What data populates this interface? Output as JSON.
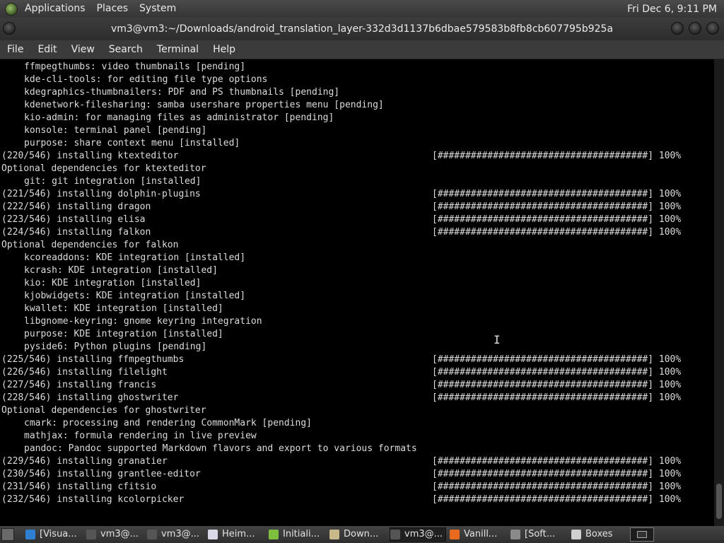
{
  "top_panel": {
    "menus": [
      "Applications",
      "Places",
      "System"
    ],
    "clock": "Fri Dec 6,  9:11 PM"
  },
  "window": {
    "title": "vm3@vm3:~/Downloads/android_translation_layer-332d3d1137b6dbae579583b8fb8cb607795b925a"
  },
  "menubar": [
    "File",
    "Edit",
    "View",
    "Search",
    "Terminal",
    "Help"
  ],
  "terminal": {
    "lines": [
      {
        "indent": true,
        "text": "ffmpegthumbs: video thumbnails [pending]",
        "bar": ""
      },
      {
        "indent": true,
        "text": "kde-cli-tools: for editing file type options",
        "bar": ""
      },
      {
        "indent": true,
        "text": "kdegraphics-thumbnailers: PDF and PS thumbnails [pending]",
        "bar": ""
      },
      {
        "indent": true,
        "text": "kdenetwork-filesharing: samba usershare properties menu [pending]",
        "bar": ""
      },
      {
        "indent": true,
        "text": "kio-admin: for managing files as administrator [pending]",
        "bar": ""
      },
      {
        "indent": true,
        "text": "konsole: terminal panel [pending]",
        "bar": ""
      },
      {
        "indent": true,
        "text": "purpose: share context menu [installed]",
        "bar": ""
      },
      {
        "indent": false,
        "text": "(220/546) installing ktexteditor",
        "bar": "[######################################] 100%"
      },
      {
        "indent": false,
        "text": "Optional dependencies for ktexteditor",
        "bar": ""
      },
      {
        "indent": true,
        "text": "git: git integration [installed]",
        "bar": ""
      },
      {
        "indent": false,
        "text": "(221/546) installing dolphin-plugins",
        "bar": "[######################################] 100%"
      },
      {
        "indent": false,
        "text": "(222/546) installing dragon",
        "bar": "[######################################] 100%"
      },
      {
        "indent": false,
        "text": "(223/546) installing elisa",
        "bar": "[######################################] 100%"
      },
      {
        "indent": false,
        "text": "(224/546) installing falkon",
        "bar": "[######################################] 100%"
      },
      {
        "indent": false,
        "text": "Optional dependencies for falkon",
        "bar": ""
      },
      {
        "indent": true,
        "text": "kcoreaddons: KDE integration [installed]",
        "bar": ""
      },
      {
        "indent": true,
        "text": "kcrash: KDE integration [installed]",
        "bar": ""
      },
      {
        "indent": true,
        "text": "kio: KDE integration [installed]",
        "bar": ""
      },
      {
        "indent": true,
        "text": "kjobwidgets: KDE integration [installed]",
        "bar": ""
      },
      {
        "indent": true,
        "text": "kwallet: KDE integration [installed]",
        "bar": ""
      },
      {
        "indent": true,
        "text": "libgnome-keyring: gnome keyring integration",
        "bar": ""
      },
      {
        "indent": true,
        "text": "purpose: KDE integration [installed]",
        "bar": ""
      },
      {
        "indent": true,
        "text": "pyside6: Python plugins [pending]",
        "bar": ""
      },
      {
        "indent": false,
        "text": "(225/546) installing ffmpegthumbs",
        "bar": "[######################################] 100%"
      },
      {
        "indent": false,
        "text": "(226/546) installing filelight",
        "bar": "[######################################] 100%"
      },
      {
        "indent": false,
        "text": "(227/546) installing francis",
        "bar": "[######################################] 100%"
      },
      {
        "indent": false,
        "text": "(228/546) installing ghostwriter",
        "bar": "[######################################] 100%"
      },
      {
        "indent": false,
        "text": "Optional dependencies for ghostwriter",
        "bar": ""
      },
      {
        "indent": true,
        "text": "cmark: processing and rendering CommonMark [pending]",
        "bar": ""
      },
      {
        "indent": true,
        "text": "mathjax: formula rendering in live preview",
        "bar": ""
      },
      {
        "indent": true,
        "text": "pandoc: Pandoc supported Markdown flavors and export to various formats",
        "bar": ""
      },
      {
        "indent": false,
        "text": "(229/546) installing granatier",
        "bar": "[######################################] 100%"
      },
      {
        "indent": false,
        "text": "(230/546) installing grantlee-editor",
        "bar": "[######################################] 100%"
      },
      {
        "indent": false,
        "text": "(231/546) installing cfitsio",
        "bar": "[######################################] 100%"
      },
      {
        "indent": false,
        "text": "(232/546) installing kcolorpicker",
        "bar": "[######################################] 100%"
      }
    ]
  },
  "taskbar": {
    "tasks": [
      {
        "label": "[Visua...",
        "icon": "vscode-icon",
        "color": "#2f7fd0",
        "active": false
      },
      {
        "label": "vm3@...",
        "icon": "terminal-icon",
        "color": "#555555",
        "active": false
      },
      {
        "label": "vm3@...",
        "icon": "terminal-icon",
        "color": "#555555",
        "active": false
      },
      {
        "label": "Heim...",
        "icon": "document-icon",
        "color": "#d8d8e8",
        "active": false
      },
      {
        "label": "Initiali...",
        "icon": "android-icon",
        "color": "#7fbf3f",
        "active": false
      },
      {
        "label": "Down...",
        "icon": "folder-icon",
        "color": "#c8b88a",
        "active": false
      },
      {
        "label": "vm3@...",
        "icon": "terminal-icon",
        "color": "#555555",
        "active": true
      },
      {
        "label": "Vanill...",
        "icon": "firefox-icon",
        "color": "#e76a1e",
        "active": false
      },
      {
        "label": "[Soft...",
        "icon": "software-icon",
        "color": "#8a8a8a",
        "active": false
      },
      {
        "label": "Boxes",
        "icon": "boxes-icon",
        "color": "#cfcfcf",
        "active": false
      }
    ]
  }
}
